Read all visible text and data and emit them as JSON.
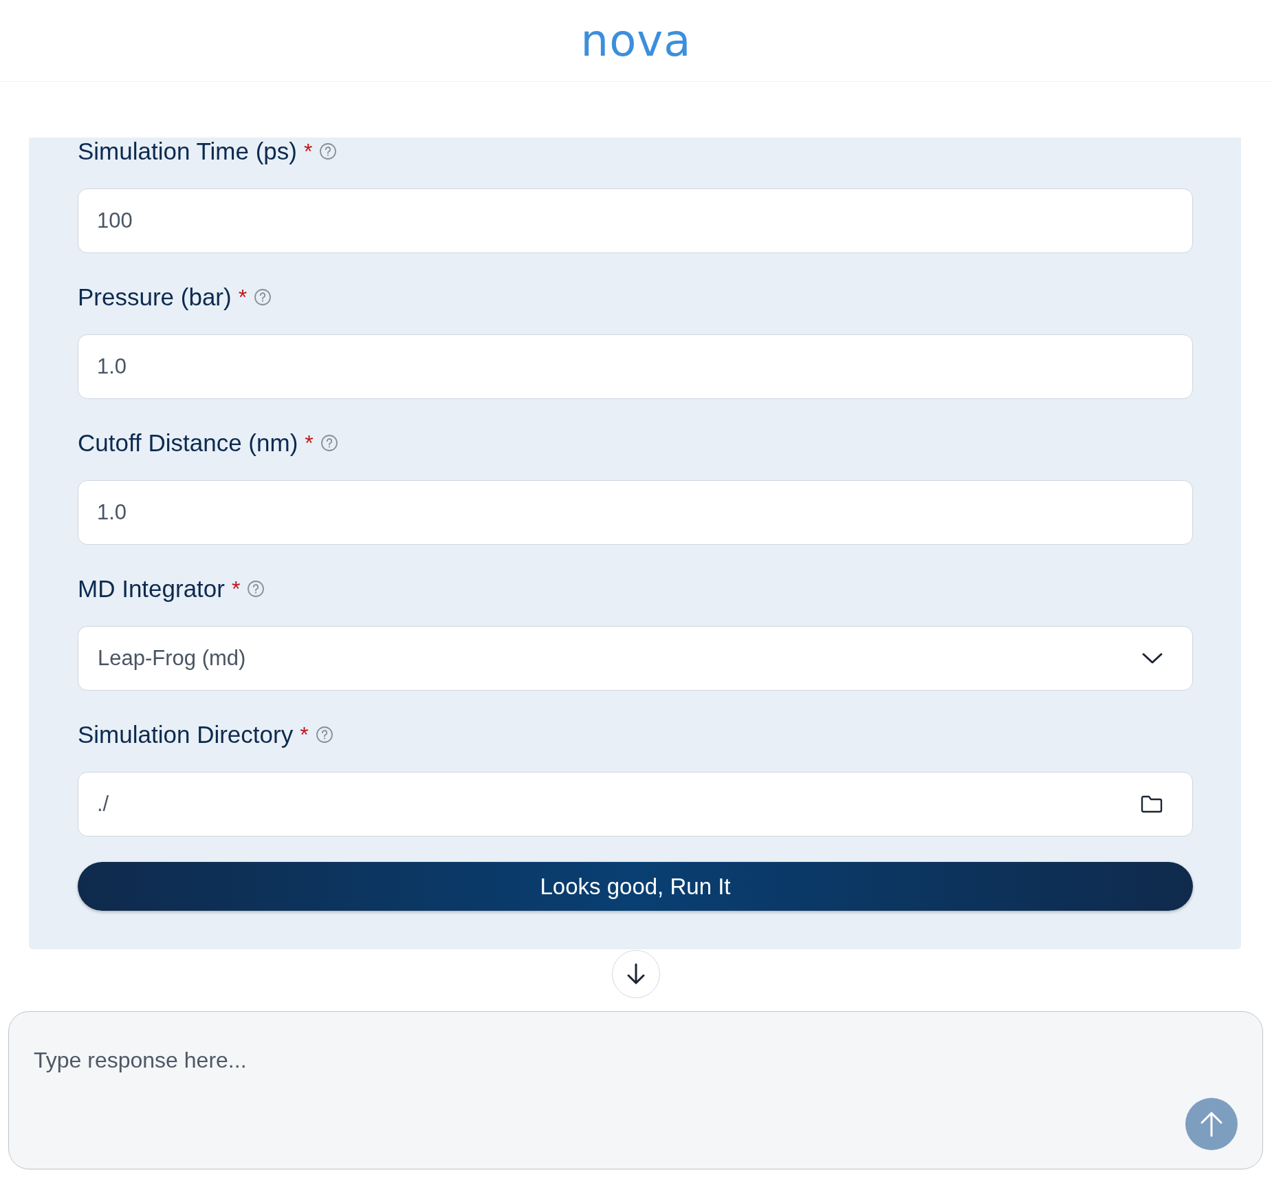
{
  "header": {
    "logo": "nova"
  },
  "form": {
    "fields": [
      {
        "label": "Simulation Time (ps)",
        "required_mark": "*",
        "kind": "text",
        "value": "100"
      },
      {
        "label": "Pressure (bar)",
        "required_mark": "*",
        "kind": "text",
        "value": "1.0"
      },
      {
        "label": "Cutoff Distance (nm)",
        "required_mark": "*",
        "kind": "text",
        "value": "1.0"
      },
      {
        "label": "MD Integrator",
        "required_mark": "*",
        "kind": "select",
        "value": "Leap-Frog (md)"
      },
      {
        "label": "Simulation Directory",
        "required_mark": "*",
        "kind": "folder",
        "value": "./"
      }
    ],
    "submit": "Looks good, Run It"
  },
  "composer": {
    "placeholder": "Type response here..."
  }
}
